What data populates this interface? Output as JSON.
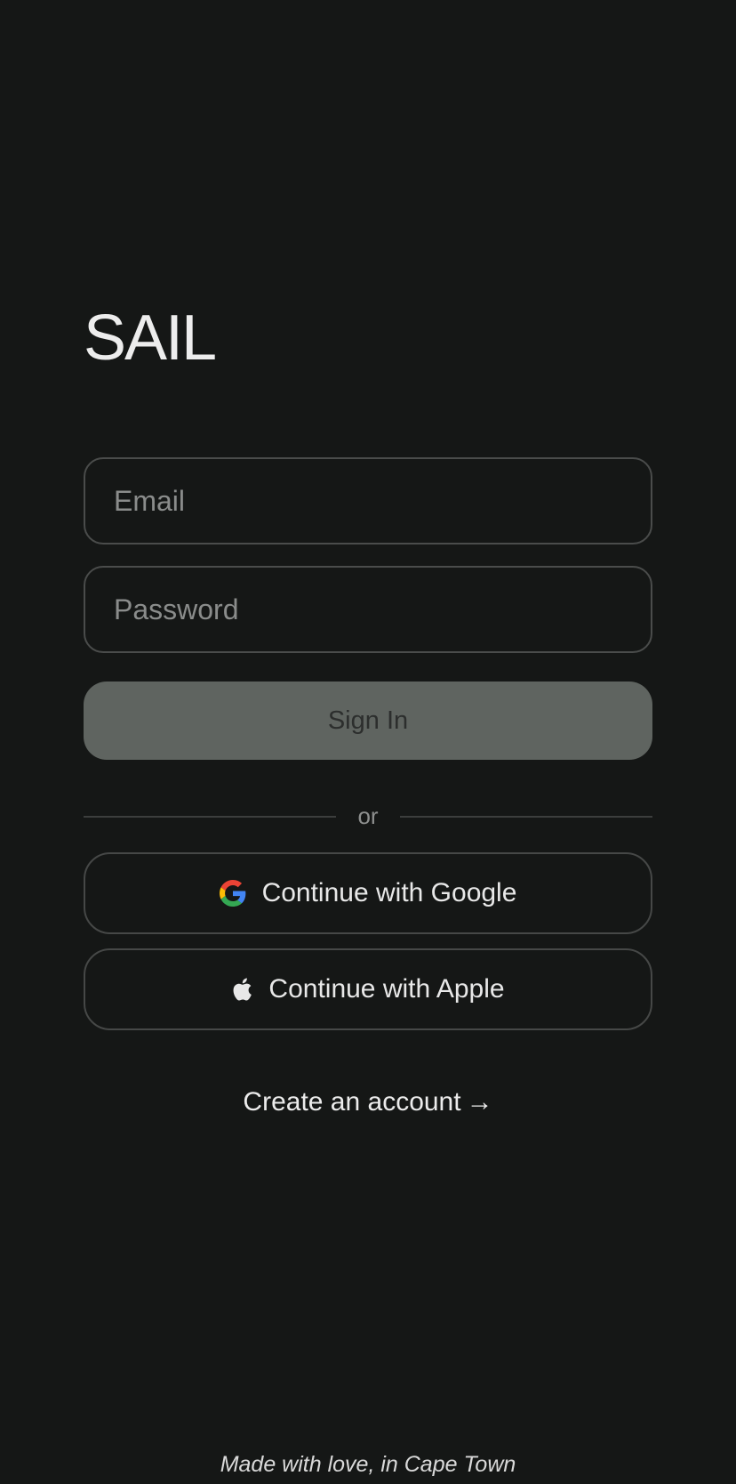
{
  "brand": {
    "title": "SAIL"
  },
  "form": {
    "email_placeholder": "Email",
    "password_placeholder": "Password",
    "signin_label": "Sign In"
  },
  "divider": {
    "label": "or"
  },
  "social": {
    "google_label": "Continue with Google",
    "google_icon": "google-g-icon",
    "apple_label": "Continue with Apple",
    "apple_icon": "apple-icon"
  },
  "create_account": {
    "label": "Create an account",
    "arrow": "→"
  },
  "footer": {
    "text": "Made with love, in Cape Town"
  },
  "colors": {
    "background": "#151716",
    "signin_button": "#5f6460",
    "border": "#4a4c4b",
    "text": "#ededed"
  }
}
